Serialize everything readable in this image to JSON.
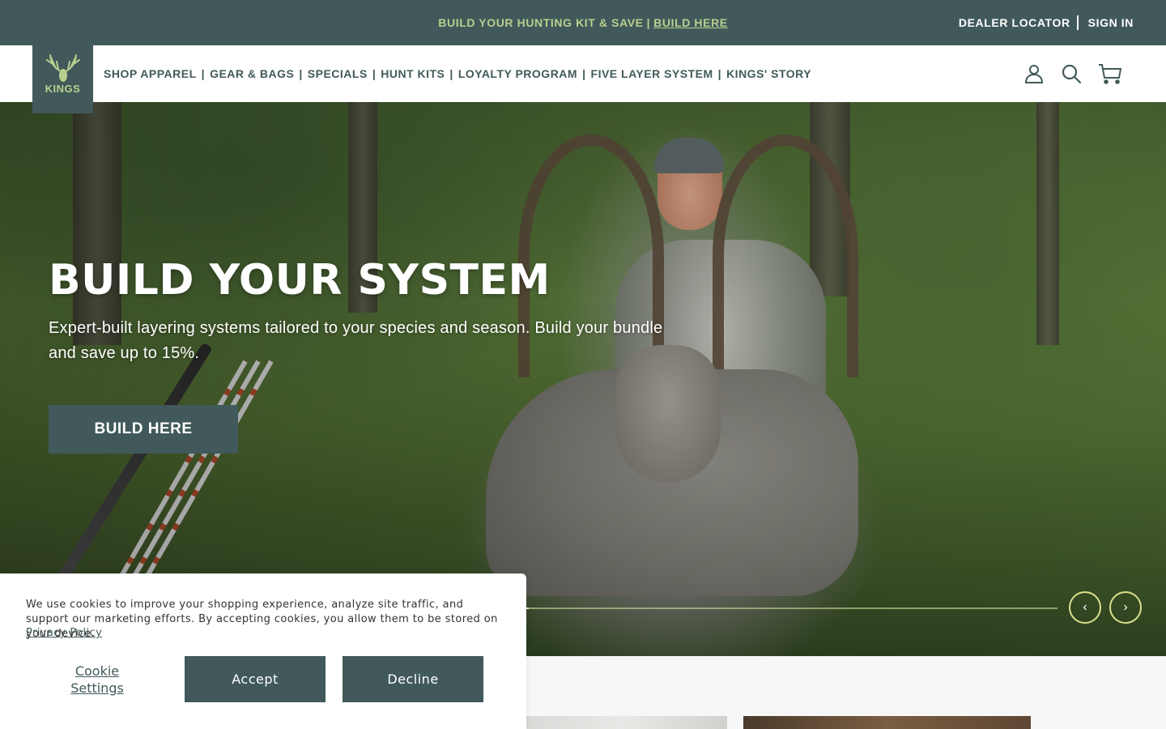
{
  "announcement": {
    "message": "BUILD YOUR HUNTING KIT & SAVE",
    "separator": "|",
    "link": "BUILD HERE"
  },
  "utility": {
    "dealer_locator": "DEALER LOCATOR",
    "sign_in": "SIGN IN"
  },
  "logo": {
    "text": "KINGS"
  },
  "nav": {
    "items": [
      "SHOP APPAREL",
      "GEAR & BAGS",
      "SPECIALS",
      "HUNT KITS",
      "LOYALTY PROGRAM",
      "FIVE LAYER SYSTEM",
      "KINGS' STORY"
    ],
    "separator": "|"
  },
  "header_icons": [
    "account-icon",
    "search-icon",
    "cart-icon"
  ],
  "hero": {
    "title": "BUILD YOUR SYSTEM",
    "subtitle": "Expert-built layering systems tailored to your species and season. Build your bundle and save up to 15%.",
    "button": "BUILD HERE",
    "slide_progress": 0.5
  },
  "cookie_banner": {
    "text": "We use cookies to improve your shopping experience, analyze site traffic, and support our marketing efforts. By accepting cookies, you allow them to be stored on your device.",
    "privacy_link": "Privacy Policy",
    "settings": "Cookie Settings",
    "accept": "Accept",
    "decline": "Decline"
  },
  "colors": {
    "brand": "#41595a",
    "accent": "#b9cf8f",
    "white": "#ffffff"
  }
}
